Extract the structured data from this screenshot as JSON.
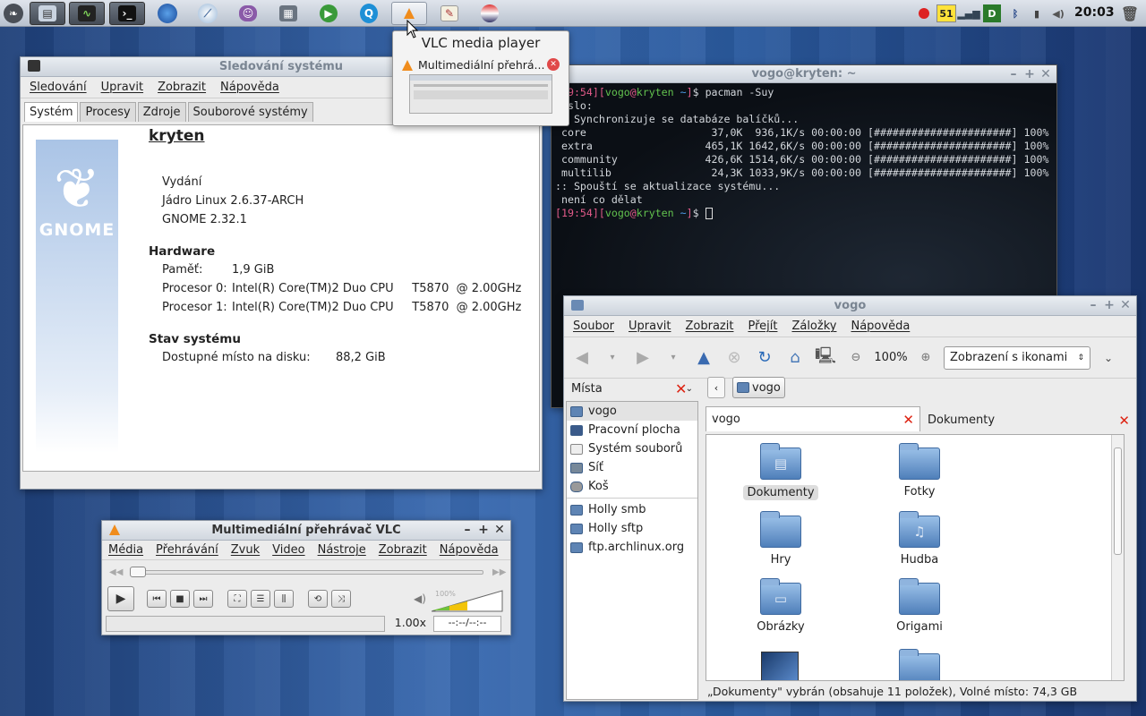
{
  "panel": {
    "clock": "20:03",
    "tray_badge": "51"
  },
  "sysmon": {
    "title": "Sledování systému",
    "menu": [
      "Sledování",
      "Upravit",
      "Zobrazit",
      "Nápověda"
    ],
    "tabs": [
      "Systém",
      "Procesy",
      "Zdroje",
      "Souborové systémy"
    ],
    "logo_text": "GNOME",
    "hostname": "kryten",
    "release": "Vydání",
    "kernel": "Jádro Linux 2.6.37-ARCH",
    "gnome": "GNOME 2.32.1",
    "hardware_heading": "Hardware",
    "mem_label": "Paměť:",
    "mem_value": "1,9 GiB",
    "cpu0_label": "Procesor 0:",
    "cpu0_value": "Intel(R) Core(TM)2 Duo CPU     T5870  @ 2.00GHz",
    "cpu1_label": "Procesor 1:",
    "cpu1_value": "Intel(R) Core(TM)2 Duo CPU     T5870  @ 2.00GHz",
    "status_heading": "Stav systému",
    "disk_label": "Dostupné místo na disku:",
    "disk_value": "88,2 GiB"
  },
  "terminal": {
    "title": "vogo@kryten: ~",
    "lines": [
      {
        "time": "[19:54]",
        "user": "vogo",
        "host": "kryten",
        "cwd": "~",
        "cmd": "$ pacman -Suy"
      },
      {
        "text": "Heslo:"
      },
      {
        "text": ":: Synchronizuje se databáze balíčků..."
      },
      {
        "text": " core                    37,0K  936,1K/s 00:00:00 [######################] 100%"
      },
      {
        "text": " extra                  465,1K 1642,6K/s 00:00:00 [######################] 100%"
      },
      {
        "text": " community              426,6K 1514,6K/s 00:00:00 [######################] 100%"
      },
      {
        "text": " multilib                24,3K 1033,9K/s 00:00:00 [######################] 100%"
      },
      {
        "text": ":: Spouští se aktualizace systému..."
      },
      {
        "text": " není co dělat"
      },
      {
        "time": "[19:54]",
        "user": "vogo",
        "host": "kryten",
        "cwd": "~",
        "cmd": "$ "
      }
    ]
  },
  "files": {
    "title": "vogo",
    "menu": [
      "Soubor",
      "Upravit",
      "Zobrazit",
      "Přejít",
      "Záložky",
      "Nápověda"
    ],
    "zoom": "100%",
    "view_mode": "Zobrazení s ikonami",
    "places_label": "Místa",
    "path_button": "vogo",
    "sidebar": [
      "vogo",
      "Pracovní plocha",
      "Systém souborů",
      "Síť",
      "Koš"
    ],
    "bookmarks": [
      "Holly smb",
      "Holly sftp",
      "ftp.archlinux.org"
    ],
    "tabs": [
      "vogo",
      "Dokumenty"
    ],
    "items": [
      "Dokumenty",
      "Fotky",
      "Hry",
      "Hudba",
      "Obrázky",
      "Origami"
    ],
    "status": "„Dokumenty\" vybrán (obsahuje 11 položek), Volné místo: 74,3 GB"
  },
  "vlc": {
    "title": "Multimediální přehrávač VLC",
    "menu": [
      "Média",
      "Přehrávání",
      "Zvuk",
      "Video",
      "Nástroje",
      "Zobrazit",
      "Nápověda"
    ],
    "volume": "100%",
    "speed": "1.00x",
    "time": "--:--/--:--"
  },
  "popup": {
    "title": "VLC media player",
    "item": "Multimediální přehrá..."
  }
}
